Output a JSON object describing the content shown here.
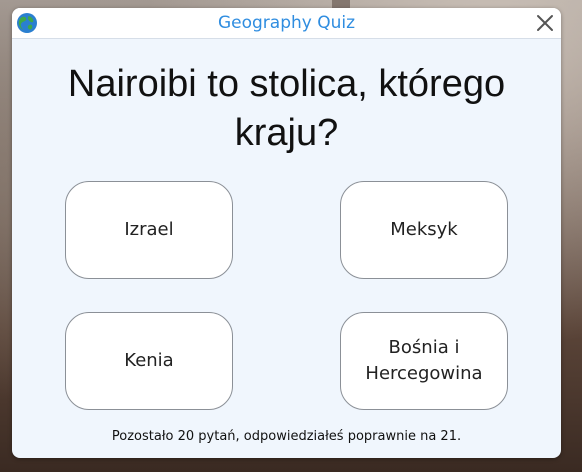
{
  "window": {
    "title": "Geography Quiz",
    "icon": "globe-icon",
    "close_icon": "close-icon"
  },
  "quiz": {
    "question": "Nairoibi to stolica, którego kraju?",
    "answers": [
      {
        "label": "Izrael"
      },
      {
        "label": "Meksyk"
      },
      {
        "label": "Kenia"
      },
      {
        "label": "Bośnia i Hercegowina"
      }
    ],
    "status": "Pozostało 20 pytań, odpowiedziałeś poprawnie na 21."
  },
  "colors": {
    "title": "#2f8de0",
    "window_bg": "#f0f6fd",
    "button_border": "#8b9097"
  }
}
